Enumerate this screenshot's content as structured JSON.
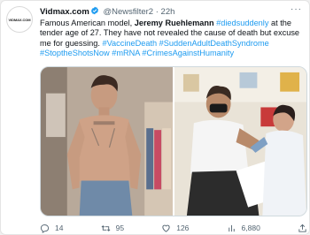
{
  "account": {
    "avatar_text": "VIDMAX.COM",
    "name": "Vidmax.com",
    "handle": "@Newsfilter2",
    "separator": "·",
    "time": "22h",
    "more": "···"
  },
  "tweet": {
    "part1": "Famous American model, ",
    "bold_name": "Jeremy Ruehlemann",
    "tag1": " #diedsuddenly",
    "part2": " at the tender age of 27. They have not revealed the cause of death but excuse me for guessing. ",
    "tag2": "#VaccineDeath",
    "tag3": " #SuddenAdultDeathSyndrome",
    "tag4": " #StoptheShotsNow",
    "tag5": " #mRNA",
    "tag6": " #CrimesAgainstHumanity"
  },
  "actions": {
    "replies": "14",
    "retweets": "95",
    "likes": "126",
    "views": "6,880"
  },
  "icons": [
    "verified-icon",
    "more-icon",
    "reply-icon",
    "retweet-icon",
    "like-icon",
    "views-icon",
    "share-icon"
  ],
  "colors": {
    "link": "#1d9bf0",
    "muted": "#536471",
    "text": "#0f1419"
  }
}
